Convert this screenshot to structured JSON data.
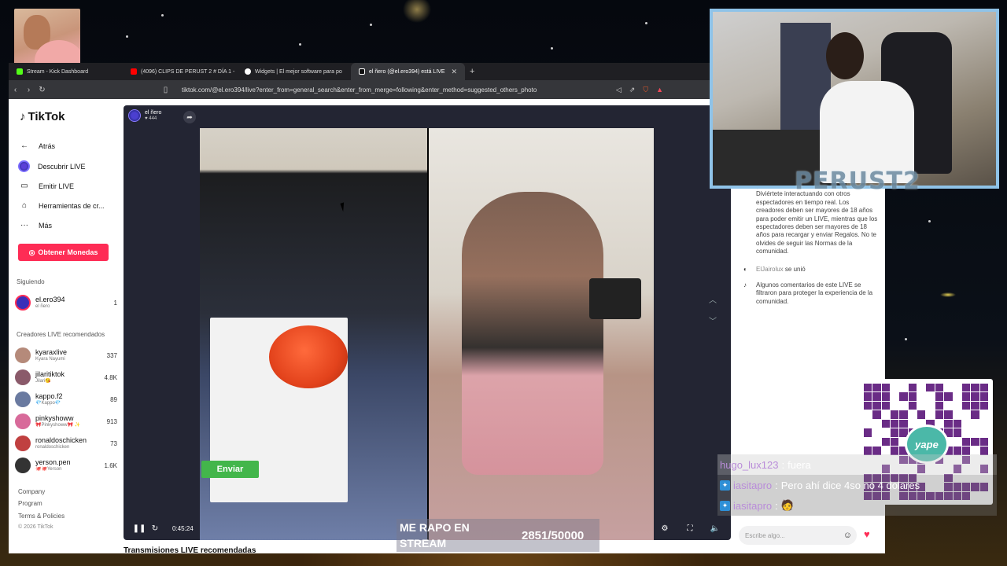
{
  "browser": {
    "tabs": [
      {
        "label": "Stream - Kick Dashboard",
        "icon": "kick-icon",
        "color": "#53fc18"
      },
      {
        "label": "(4096) CLIPS DE PERUST 2 # DÍA 1 -",
        "icon": "youtube-icon",
        "color": "#ff0000"
      },
      {
        "label": "Widgets | El mejor software para po",
        "icon": "widget-icon",
        "color": "#ffffff"
      },
      {
        "label": "el ñero (@el.ero394) está LIVE",
        "icon": "tiktok-icon",
        "color": "#ffffff",
        "active": true
      }
    ],
    "new_tab": "+",
    "url": "tiktok.com/@el.ero394/live?enter_from=general_search&enter_from_merge=following&enter_method=suggested_others_photo"
  },
  "sidebar": {
    "logo": "TikTok",
    "nav": [
      {
        "label": "Atrás",
        "icon": "back-arrow-icon"
      },
      {
        "label": "Descubrir LIVE",
        "icon": "live-ring-icon"
      },
      {
        "label": "Emitir LIVE",
        "icon": "camera-icon"
      },
      {
        "label": "Herramientas de cr...",
        "icon": "home-icon"
      },
      {
        "label": "Más",
        "icon": "more-icon"
      }
    ],
    "coins_button": "Obtener Monedas",
    "following_label": "Siguiendo",
    "following": [
      {
        "name": "el.ero394",
        "sub": "el ñero",
        "count": "1",
        "color": "#3b2fb8"
      }
    ],
    "recommended_label": "Creadores LIVE recomendados",
    "recommended": [
      {
        "name": "kyaraxlive",
        "sub": "Kyara Nayumi",
        "count": "337",
        "color": "#b58a7a"
      },
      {
        "name": "jilaritiktok",
        "sub": "Jilari😘",
        "count": "4.8K",
        "color": "#8a5a6a"
      },
      {
        "name": "kappo.f2",
        "sub": "💎Kappo💎",
        "count": "89",
        "color": "#6a7aa0"
      },
      {
        "name": "pinkyshoww",
        "sub": "🎀Pinkyshoww🎀 ✨",
        "count": "913",
        "color": "#d86a9a"
      },
      {
        "name": "ronaldoschicken",
        "sub": "ronaldoschicken",
        "count": "73",
        "color": "#c04040"
      },
      {
        "name": "yerson.pen",
        "sub": "🐙🐙Yerson",
        "count": "1.6K",
        "color": "#333333"
      }
    ],
    "footer": [
      "Company",
      "Program",
      "Terms & Policies",
      "© 2026 TikTok"
    ]
  },
  "player": {
    "host_name": "el ñero",
    "host_likes": "♥ 444",
    "send_button": "Enviar",
    "timer": "0:45:24"
  },
  "chat": {
    "messages": [
      {
        "text": "¡Te damos la bienvenida a TikTok LIVE! Diviértete interactuando con otros espectadores en tiempo real. Los creadores deben ser mayores de 18 años para poder emitir un LIVE, mientras que los espectadores deben ser mayores de 18 años para recargar y enviar Regalos. No te olvides de seguir las Normas de la comunidad."
      },
      {
        "user": "ElJairolux",
        "text": "se unió"
      },
      {
        "text": "Algunos comentarios de este LIVE se filtraron para proteger la experiencia de la comunidad."
      }
    ],
    "input_placeholder": "Escribe algo..."
  },
  "recommended_heading": "Transmisiones LIVE recomendadas",
  "overlay": {
    "webcam_name": "PERUST2",
    "yape_label": "yape",
    "chat": [
      {
        "user": "hugo_lux123",
        "sep": ":",
        "msg": "fuera"
      },
      {
        "user": "iasitapro",
        "sep": ":",
        "msg": "Pero ahí dice 4so no 4 dolares"
      },
      {
        "user": "iasitapro",
        "sep": ":",
        "msg": "🧑"
      }
    ],
    "caption": "ME RAPO EN STREAM",
    "goal": "2851/50000"
  }
}
